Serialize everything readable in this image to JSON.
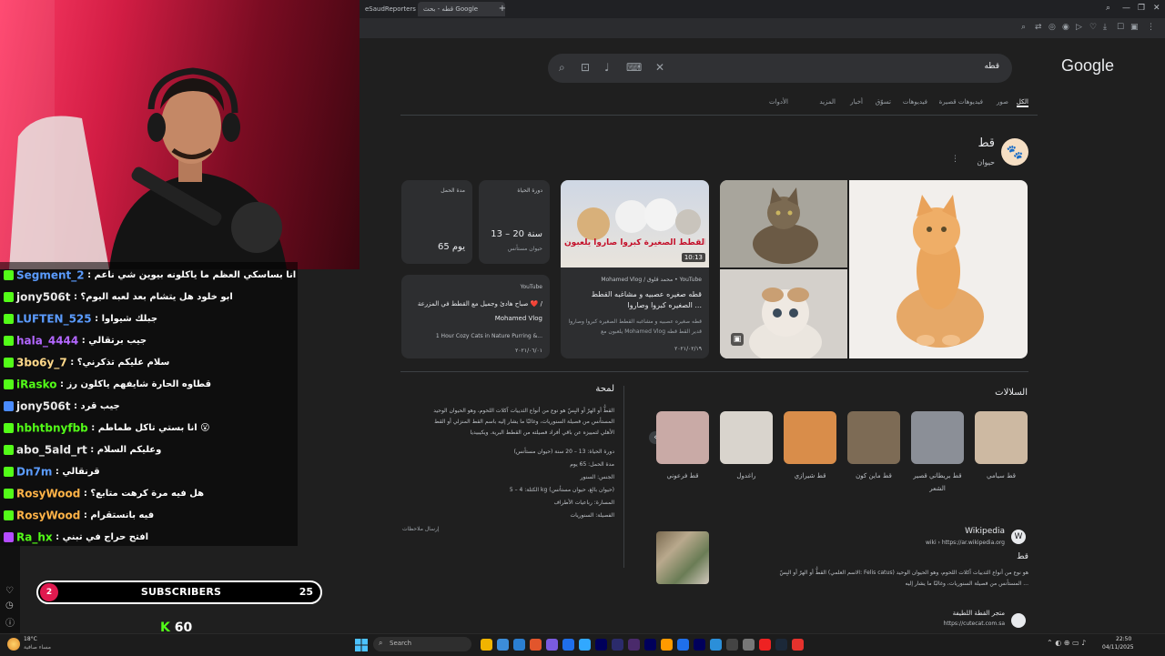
{
  "browser": {
    "tabs": [
      {
        "label": "eSaudReporters | تويتر"
      },
      {
        "label": "قطه - بحث Google"
      }
    ],
    "new_tab": "+"
  },
  "google": {
    "logo": "Google",
    "query": "قطه",
    "tabs": [
      "الكل",
      "صور",
      "فيديوهات قصيرة",
      "فيديوهات",
      "تسوّق",
      "أخبار",
      "المزيد",
      "الأدوات"
    ],
    "knowledge": {
      "title": "قط",
      "subtitle": "حيوان",
      "video_card": {
        "overlay_text": "القطط الصغيرة كبروا صاروا يلعبون",
        "duration": "10:13",
        "source": "Mohamed Vlog / محمد ڤلوق • YouTube",
        "title": "قطه صغيره عصبيه و مشاغبه القطط الصغيره كبروا وصاروا ...",
        "snippet": "قطه صغيره عصبيه و مشاغبه القطط الصغيره كبروا وصاروا يلعبون مع Mohamed Vlog قدير القط قطه",
        "date": "٢٠٢١/٠٢/١٩"
      },
      "info_cards": [
        {
          "label": "دورة الحياة",
          "value": "13 – 20 سنة",
          "sub": "حيوان مستأنس"
        },
        {
          "label": "مدة الحمل",
          "value": "65 يوم",
          "sub": ""
        }
      ],
      "yt_card": {
        "source": "YouTube",
        "title": "صباح هادئ وجميل مع القطط في المزرعة ❤️ / Mohamed Vlog",
        "snippet": "1 Hour Cozy Cats in Nature Purring &...",
        "date": "٢٠٢١/٠٦/٠١"
      }
    },
    "overview": {
      "title": "لمحة",
      "lines": [
        "القطُّ أو الهرّ أو البِسّ هو نوع من أنواع الثدييات آكلات اللحوم، وهو الحيوان الوحيد",
        "المستأنس من فصيلة السنوريات، وغالبًا ما يشار إليه باسم القط المنزلي أو القط",
        "الأهلي لتمييزه عن باقي أفراد فصيلته من القطط البرية. ويكيبيديا"
      ],
      "facts": [
        "دورة الحياة: 13 – 20 سنة (حيوان مستأنس)",
        "مدة الحمل: 65 يوم",
        "الجنس: السنور",
        "الكتلة: 4 – 5 kg (حيوان بالغ، حيوان مستأنس)",
        "المسارة: رباعيات الأطراف",
        "الفصيلة: السنوريات"
      ],
      "feedback": "إرسال ملاحظات"
    },
    "breeds": {
      "title": "السلالات",
      "items": [
        {
          "label": "قط سيامي",
          "color": "#cdb9a2"
        },
        {
          "label": "قط بريطاني قصير الشعر",
          "color": "#8b8f97"
        },
        {
          "label": "قط ماين كون",
          "color": "#7d6b55"
        },
        {
          "label": "قط شيرازي",
          "color": "#d98d4a"
        },
        {
          "label": "راغدول",
          "color": "#d9d4cd"
        },
        {
          "label": "قط فرعوني",
          "color": "#c9aaa6"
        }
      ]
    },
    "wiki": {
      "site": "Wikipedia",
      "url": "wiki › https://ar.wikipedia.org",
      "title": "قط",
      "snippet1": "القطُّ أو الهرّ أو البِسّ (الاسم العلمي: Felis catus) هو نوع من أنواع الثدييات آكلات اللحوم، وهو الحيوان الوحيد",
      "snippet2": "المستأنس من فصيلة السنوريات، وغالبًا ما يشار إليه ..."
    },
    "store": {
      "name": "متجر القطة اللطيفة",
      "url": "https://cutecat.com.sa"
    }
  },
  "chat": [
    {
      "user": "Segment_2",
      "text": "انا بساسكي العظم ما ياكلونه بيوين شي ناعم",
      "color": "#5b9cff",
      "badge": "kick"
    },
    {
      "user": "jony506t",
      "text": "ابو خلود هل يتشام بعد لعبه اليوم؟",
      "color": "#e8e8e8",
      "badge": "kick"
    },
    {
      "user": "LUFTEN_525",
      "text": "جبلك شيواوا",
      "color": "#5b9cff",
      "badge": "kick"
    },
    {
      "user": "hala_4444",
      "text": "جيب برتقالي",
      "color": "#b367ff",
      "badge": "kick"
    },
    {
      "user": "3bo6y_7",
      "text": "سلام عليكم تذكرني؟",
      "color": "#ffd98a",
      "badge": "kick"
    },
    {
      "user": "iRasko",
      "text": "قطاوه الحارة شايفهم ياكلون رز",
      "color": "#53fc18",
      "badge": "kick"
    },
    {
      "user": "jony506t",
      "text": "جيب قرد",
      "color": "#e8e8e8",
      "badge": "blue"
    },
    {
      "user": "hbhtbnyfbb",
      "text": "انا بستي تاكل طماطم 😮",
      "color": "#53fc18",
      "badge": "kick"
    },
    {
      "user": "abo_5ald_rt",
      "text": "وعليكم السلام",
      "color": "#e8e8e8",
      "badge": "kick"
    },
    {
      "user": "Dn7m",
      "text": "قرنقالي",
      "color": "#5b9cff",
      "badge": "kick"
    },
    {
      "user": "RosyWood",
      "text": "هل فيه مرة كرهت متابع؟",
      "color": "#ffb347",
      "badge": "kick"
    },
    {
      "user": "RosyWood",
      "text": "فيه بانستقرام",
      "color": "#ffb347",
      "badge": "kick"
    },
    {
      "user": "Ra_hx",
      "text": "افتح حراج في تبني",
      "color": "#53fc18",
      "badge": "purple"
    }
  ],
  "subs": {
    "count": "2",
    "label": "SUBSCRIBERS",
    "goal": "25"
  },
  "kick_count": "60",
  "taskbar": {
    "weather_temp": "18°C",
    "weather_desc": "مساء صافية",
    "search_placeholder": "Search",
    "time": "22:50",
    "date": "04/11/2025"
  }
}
